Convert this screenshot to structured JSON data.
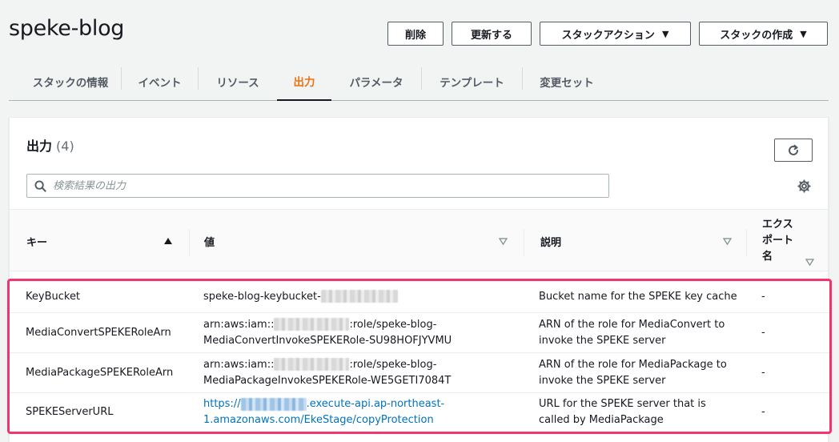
{
  "page": {
    "title": "speke-blog"
  },
  "actions": {
    "delete_label": "削除",
    "update_label": "更新する",
    "stack_actions_label": "スタックアクション",
    "create_stack_label": "スタックの作成"
  },
  "tabs": [
    {
      "label": "スタックの情報",
      "active": false
    },
    {
      "label": "イベント",
      "active": false
    },
    {
      "label": "リソース",
      "active": false
    },
    {
      "label": "出力",
      "active": true
    },
    {
      "label": "パラメータ",
      "active": false
    },
    {
      "label": "テンプレート",
      "active": false
    },
    {
      "label": "変更セット",
      "active": false
    }
  ],
  "outputs_panel": {
    "title": "出力",
    "count": "(4)",
    "search_placeholder": "検索結果の出力",
    "columns": {
      "key": "キー",
      "value": "値",
      "description": "説明",
      "export_name_line1": "エクス",
      "export_name_line2": "ポート",
      "export_name_line3": "名"
    },
    "rows": [
      {
        "key": "KeyBucket",
        "value_line1_a": "speke-blog-keybucket-",
        "value_line1_b": "",
        "value_line2": "",
        "description_line1": "Bucket name for the SPEKE key cache",
        "description_line2": "",
        "export": "-"
      },
      {
        "key": "MediaConvertSPEKERoleArn",
        "value_line1_a": "arn:aws:iam::",
        "value_line1_b": ":role/speke-blog-",
        "value_line2": "MediaConvertInvokeSPEKERole-SU98HOFJYVMU",
        "description_line1": "ARN of the role for MediaConvert to",
        "description_line2": "invoke the SPEKE server",
        "export": "-"
      },
      {
        "key": "MediaPackageSPEKERoleArn",
        "value_line1_a": "arn:aws:iam::",
        "value_line1_b": ":role/speke-blog-",
        "value_line2": "MediaPackageInvokeSPEKERole-WE5GETI7084T",
        "description_line1": "ARN of the role for MediaPackage to",
        "description_line2": "invoke the SPEKE server",
        "export": "-"
      },
      {
        "key": "SPEKEServerURL",
        "value_line1_a": "https://",
        "value_line1_b": ".execute-api.ap-northeast-",
        "value_line2": "1.amazonaws.com/EkeStage/copyProtection",
        "description_line1": "URL for the SPEKE server that is",
        "description_line2": "called by MediaPackage",
        "export": "-"
      }
    ]
  },
  "colors": {
    "accent_active_tab": "#ec7211",
    "link": "#0073bb",
    "highlight_border": "#f2356d"
  }
}
